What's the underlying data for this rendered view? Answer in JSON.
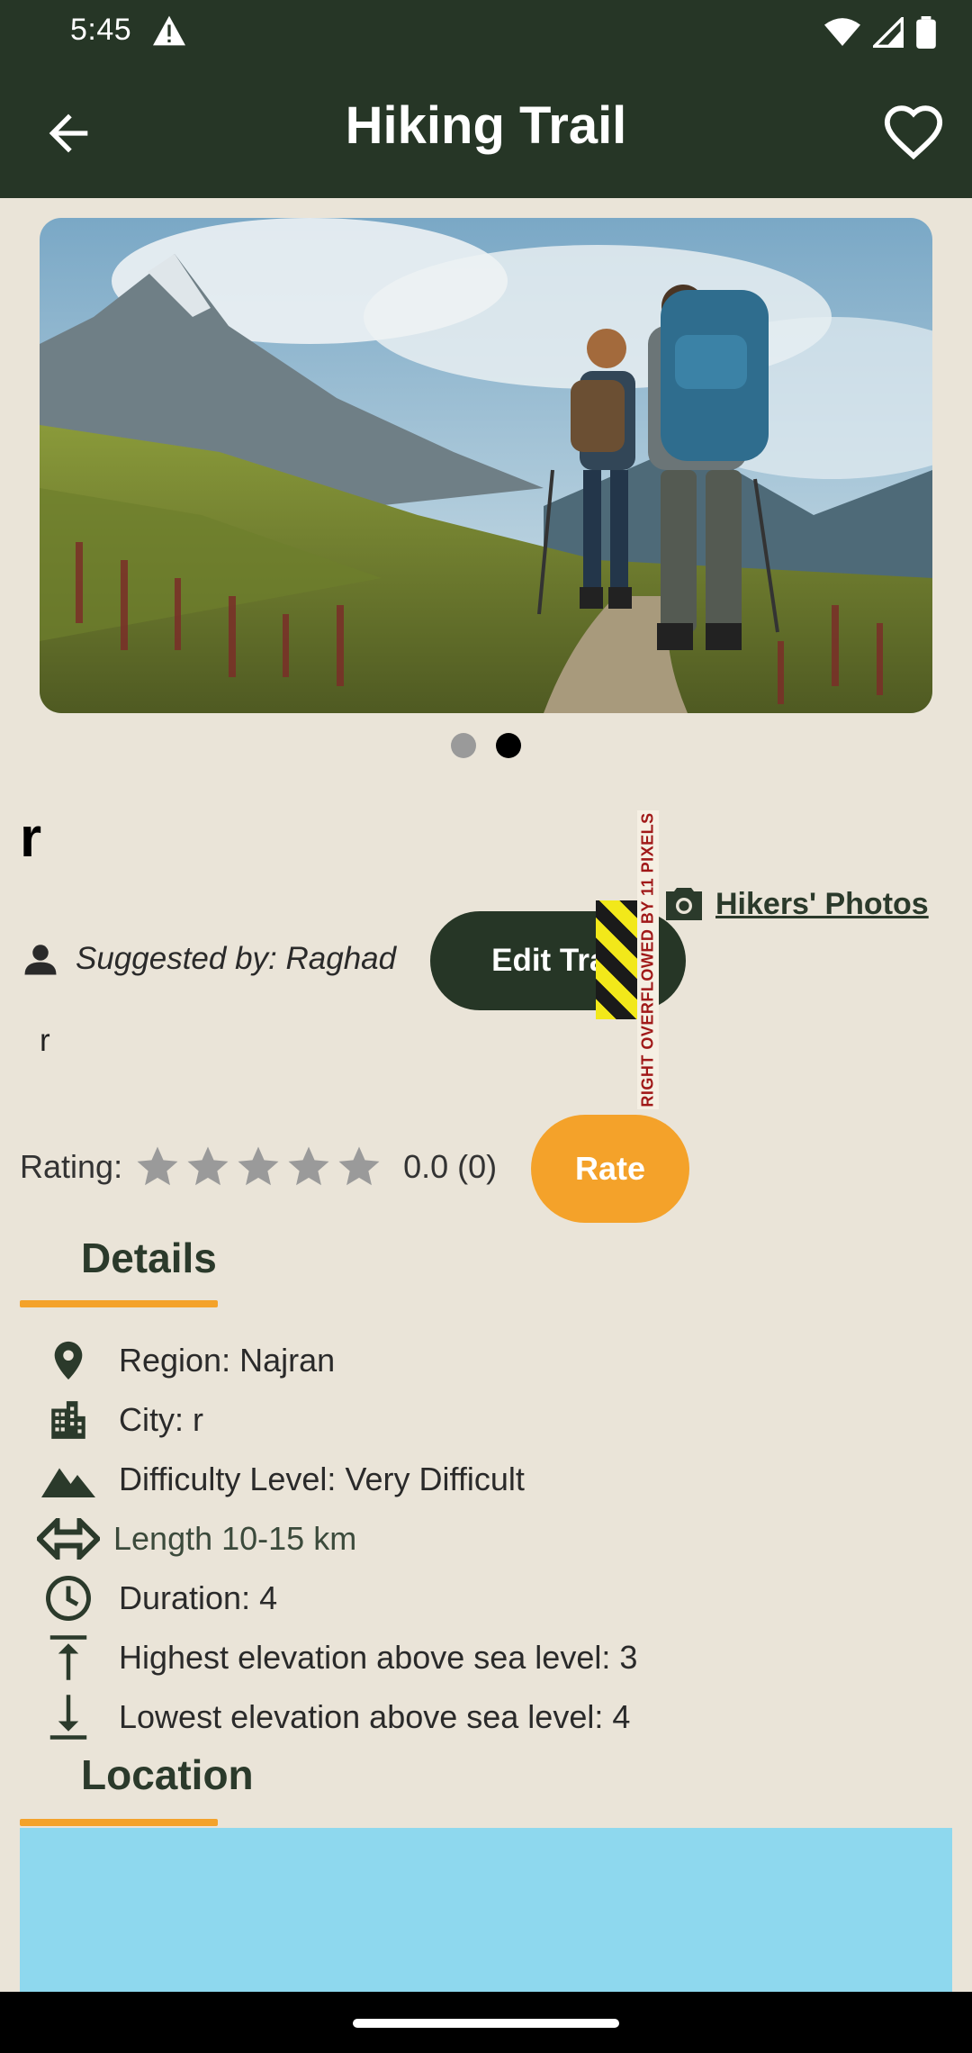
{
  "status_bar": {
    "time": "5:45"
  },
  "app_bar": {
    "title": "Hiking Trail"
  },
  "carousel": {
    "page_count": 2,
    "active_index": 1
  },
  "trail": {
    "name": "r",
    "suggested_by": "Suggested by: Raghad",
    "description": "r"
  },
  "actions": {
    "hikers_photos": "Hikers' Photos",
    "edit_trail": "Edit Trail",
    "rate": "Rate"
  },
  "overflow_banner": {
    "text": "RIGHT OVERFLOWED BY 11 PIXELS"
  },
  "rating": {
    "label": "Rating:",
    "value_text": "0.0 (0)",
    "stars": 5,
    "filled": 0
  },
  "sections": {
    "details": "Details",
    "location": "Location"
  },
  "details": {
    "region": "Region: Najran",
    "city": "City: r",
    "difficulty": "Difficulty Level: Very Difficult",
    "length": "Length 10-15 km",
    "duration": "Duration: 4",
    "highest": "Highest elevation above sea level: 3",
    "lowest": "Lowest elevation above sea level: 4"
  },
  "colors": {
    "header_bg": "#263626",
    "page_bg": "#EAE4D8",
    "accent_orange": "#F4A22A",
    "map_water": "#8ED8EE"
  }
}
